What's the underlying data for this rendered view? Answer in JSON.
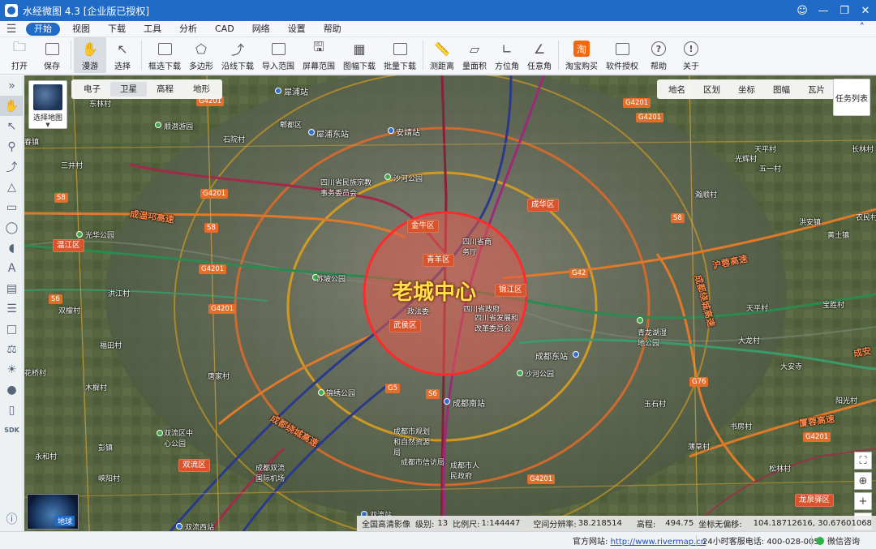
{
  "window": {
    "title": "水经微图 4.3 [企业版已授权]",
    "controls": [
      "user-icon",
      "minimize-icon",
      "restore-icon",
      "close-icon"
    ]
  },
  "menu": {
    "items": [
      "开始",
      "视图",
      "下载",
      "工具",
      "分析",
      "CAD",
      "网络",
      "设置",
      "帮助"
    ],
    "active": "开始"
  },
  "toolbar": {
    "tools": [
      {
        "label": "打开",
        "icon": "folder-icon",
        "dropdown": true
      },
      {
        "label": "保存",
        "icon": "save-icon"
      },
      {
        "label": "漫游",
        "icon": "hand-icon",
        "active": true
      },
      {
        "label": "选择",
        "icon": "pointer-icon"
      },
      {
        "label": "框选下载",
        "icon": "box-download-icon"
      },
      {
        "label": "多边形",
        "icon": "polygon-icon"
      },
      {
        "label": "沿线下载",
        "icon": "line-download-icon"
      },
      {
        "label": "导入范围",
        "icon": "import-icon"
      },
      {
        "label": "屏幕范围",
        "icon": "screen-icon"
      },
      {
        "label": "图幅下载",
        "icon": "grid-download-icon",
        "dropdown": true
      },
      {
        "label": "批量下载",
        "icon": "batch-download-icon"
      },
      {
        "label": "测距离",
        "icon": "ruler-icon"
      },
      {
        "label": "量面积",
        "icon": "area-icon"
      },
      {
        "label": "方位角",
        "icon": "azimuth-icon"
      },
      {
        "label": "任意角",
        "icon": "angle-icon"
      },
      {
        "label": "淘宝购买",
        "icon": "taobao-icon"
      },
      {
        "label": "软件授权",
        "icon": "license-icon"
      },
      {
        "label": "帮助",
        "icon": "help-icon"
      },
      {
        "label": "关于",
        "icon": "info-icon"
      }
    ]
  },
  "map": {
    "basemap_button": "选择地图",
    "layer_tabs": [
      "电子",
      "卫星",
      "高程",
      "地形"
    ],
    "layer_selected": "卫星",
    "overlay_tabs": [
      "地名",
      "区划",
      "坐标",
      "图幅",
      "瓦片"
    ],
    "task_list": "任务列表",
    "globe_label": "地球",
    "center_label": "老城中心",
    "labels": {
      "l1": "犀浦站",
      "l2": "郫都区",
      "l3": "犀浦东站",
      "l4": "安靖站",
      "l5": "东林村",
      "l6": "顺潜游园",
      "l7": "石院村",
      "l8": "春镇",
      "l9": "三井村",
      "l10": "四川省民族宗教事务委员会",
      "l11": "沙河公园",
      "l12": "光华公园",
      "l13": "温江区",
      "l14": "洪江村",
      "l15": "双檬村",
      "l16": "苏坡公园",
      "l17": "四川省商务厅",
      "l18": "四川省政府",
      "l19": "四川省发展和改革委员会",
      "l20": "政法委",
      "l21": "成都东站",
      "l22": "沙河公园",
      "l23": "青龙湖湿地公园",
      "l24": "福田村",
      "l25": "花桥村",
      "l26": "木樨村",
      "l27": "唐家村",
      "l28": "玉石村",
      "l29": "成都南站",
      "l30": "成都市规划和自然资源局",
      "l31": "成都市信访局",
      "l32": "成都市人民政府",
      "l33": "成都双流国际机场",
      "l34": "双流区中心公园",
      "l35": "彭镇",
      "l36": "永和村",
      "l37": "峡阳村",
      "l38": "双流西站",
      "l39": "双流站",
      "l40": "天平村",
      "l41": "五一村",
      "l42": "光辉村",
      "l43": "长林村",
      "l44": "瀚顺村",
      "l45": "洪安镇",
      "l46": "农民村",
      "l47": "黄土镇",
      "l48": "天平村",
      "l49": "宝胜村",
      "l50": "大龙村",
      "l51": "大安寺",
      "l52": "书房村",
      "l53": "阳光村",
      "l54": "薄草村",
      "l55": "松林村",
      "l56": "驿马公园",
      "l57": "锦绣公园",
      "l58": "龙泉驿区"
    },
    "districts": [
      "金牛区",
      "青羊区",
      "武侯区",
      "锦江区",
      "成华区",
      "温江区",
      "双流区",
      "龙泉驿区"
    ],
    "road_names": [
      "成温邛高速",
      "沪蓉高速",
      "成都绕城高速",
      "成都绕城高速",
      "厦蓉高速",
      "成安"
    ],
    "road_badges": [
      "G4201",
      "G4201",
      "G4201",
      "G4201",
      "G4201",
      "G4201",
      "S8",
      "S8",
      "G42",
      "G5",
      "S6",
      "G76",
      "G4201",
      "S8",
      "G4201",
      "S6"
    ]
  },
  "status": {
    "imagery": "全国高清影像",
    "level_label": "级别:",
    "level": "13",
    "scale_label": "比例尺:",
    "scale": "1:144447",
    "resolution_label": "空间分辨率:",
    "resolution": "38.218514",
    "elevation_label": "高程:",
    "elevation": "494.75",
    "coord_label": "坐标无偏移:",
    "coords": "104.18712616, 30.67601068",
    "site_label": "官方网站:",
    "site_url": "http://www.rivermap.cn",
    "phone": "24小时客服电话: 400-028-0050",
    "wechat": "微信咨询"
  },
  "colors": {
    "titlebar": "#1f6bc7",
    "accent": "#1f6bc7",
    "circle_fill": "#e05a4d",
    "circle_stroke": "#ff2a2a",
    "center_label": "#ffe14a",
    "taobao": "#f4690f"
  }
}
